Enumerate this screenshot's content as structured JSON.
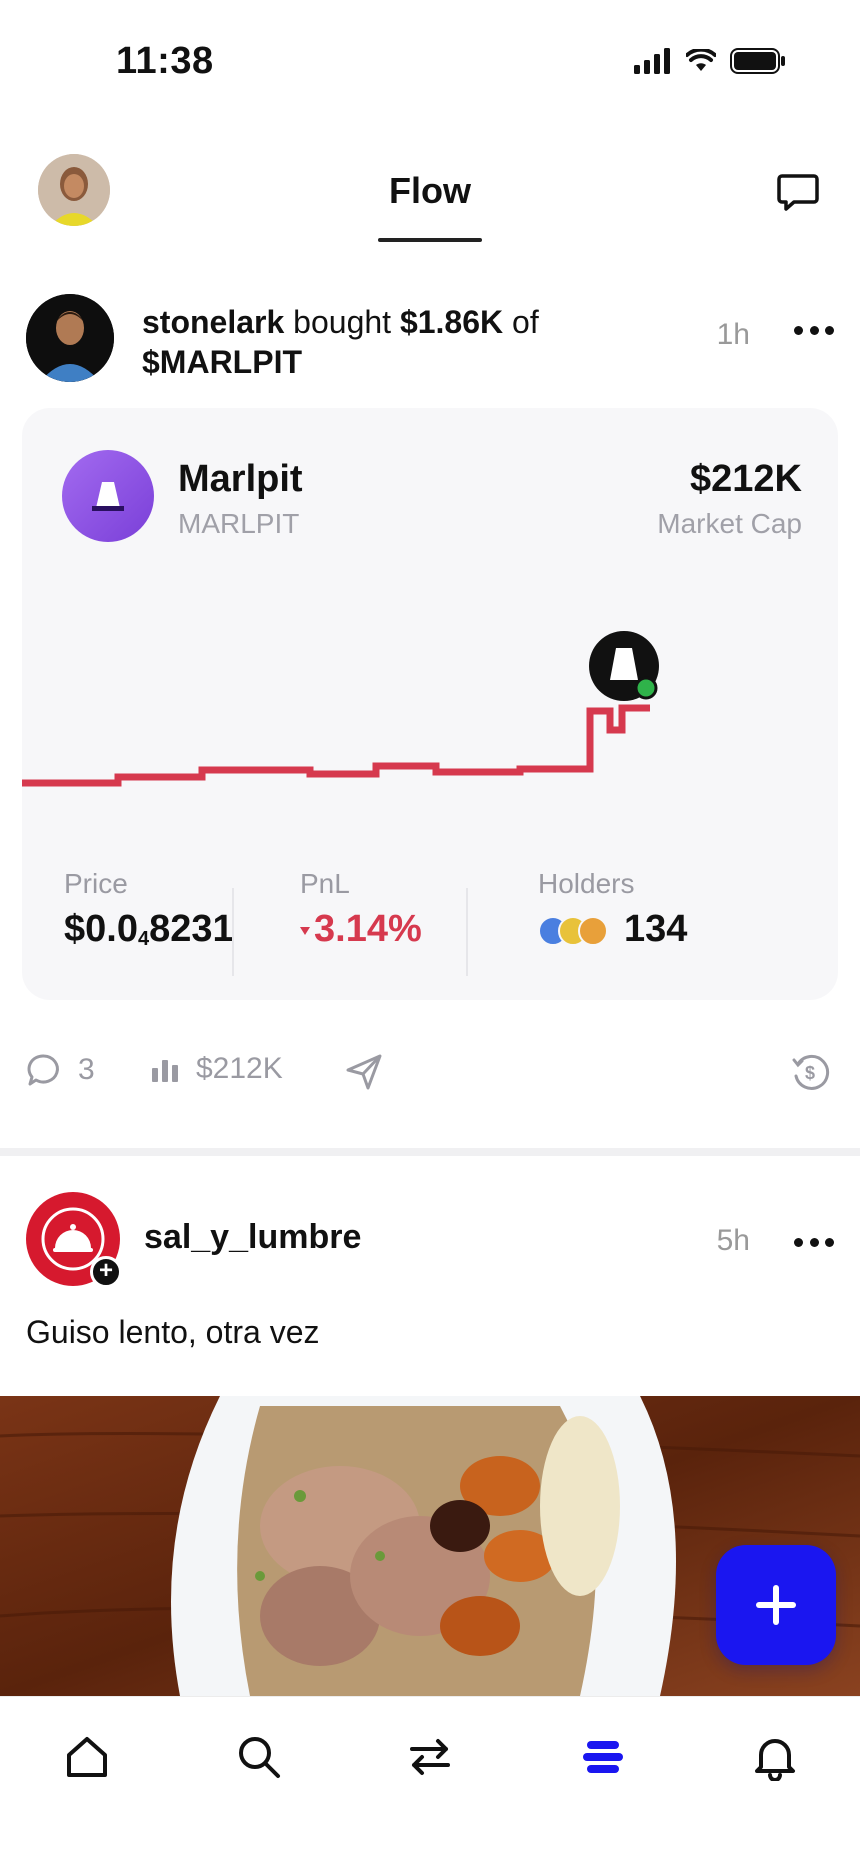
{
  "status_bar": {
    "time": "11:38"
  },
  "top_nav": {
    "title": "Flow"
  },
  "post1": {
    "user": "stonelark",
    "verb": "bought",
    "amount": "$1.86K",
    "of": "of",
    "ticker": "$MARLPIT",
    "time": "1h",
    "token": {
      "name": "Marlpit",
      "symbol": "MARLPIT",
      "market_cap": "$212K",
      "market_cap_label": "Market Cap"
    },
    "stats": {
      "price_label": "Price",
      "price_prefix": "$0.0",
      "price_sub": "4",
      "price_suffix": "8231",
      "pnl_label": "PnL",
      "pnl_value": "3.14%",
      "holders_label": "Holders",
      "holders_value": "134"
    },
    "actions": {
      "comments": "3",
      "volume": "$212K"
    },
    "colors": {
      "chart_line": "#d6394e",
      "pnl": "#d6394e"
    }
  },
  "post2": {
    "user": "sal_y_lumbre",
    "time": "5h",
    "text": "Guiso lento, otra vez"
  },
  "fab_color": "#1a16f0",
  "tabs": [
    "home-icon",
    "search-icon",
    "swap-icon",
    "feed-icon",
    "bell-icon"
  ],
  "active_tab": "feed-icon"
}
